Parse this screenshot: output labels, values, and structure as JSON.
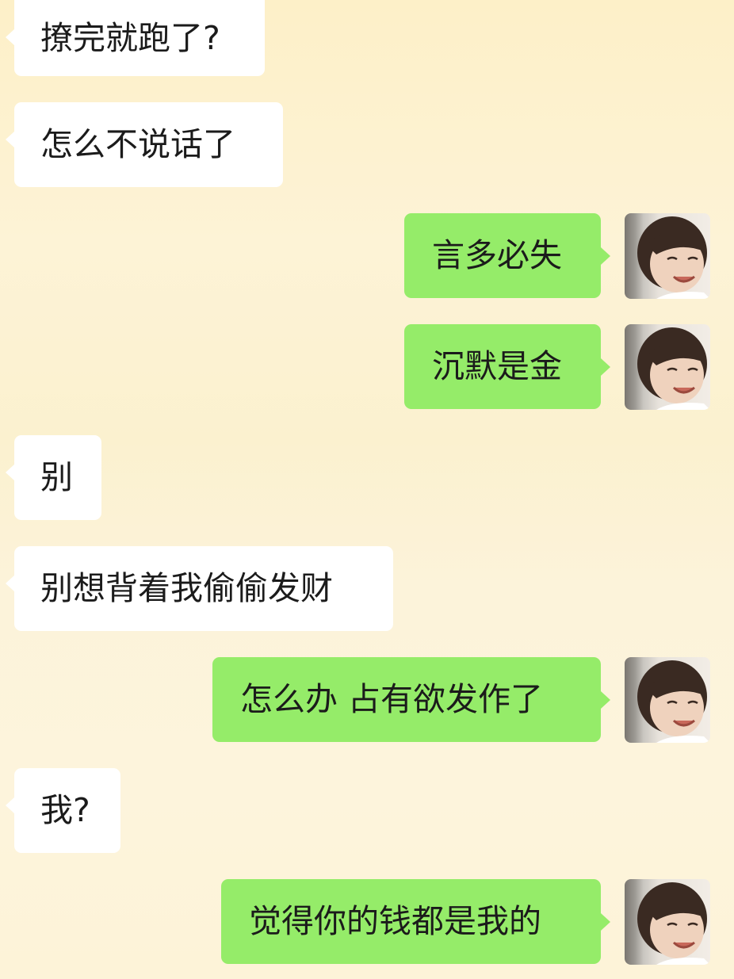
{
  "conversation": {
    "messages": [
      {
        "side": "in",
        "text": "撩完就跑了?"
      },
      {
        "side": "in",
        "text": "怎么不说话了"
      },
      {
        "side": "out",
        "text": "言多必失",
        "avatar_icon": "girl-photo-avatar"
      },
      {
        "side": "out",
        "text": "沉默是金",
        "avatar_icon": "girl-photo-avatar"
      },
      {
        "side": "in",
        "text": "别"
      },
      {
        "side": "in",
        "text": "别想背着我偷偷发财"
      },
      {
        "side": "out",
        "text": "怎么办 占有欲发作了",
        "avatar_icon": "girl-photo-avatar"
      },
      {
        "side": "in",
        "text": "我?"
      },
      {
        "side": "out",
        "text": "觉得你的钱都是我的",
        "avatar_icon": "girl-photo-avatar"
      }
    ]
  },
  "colors": {
    "incoming_bubble": "#ffffff",
    "outgoing_bubble": "#95ec69",
    "background": "#fdf2d4",
    "text": "#1b1b1b"
  }
}
